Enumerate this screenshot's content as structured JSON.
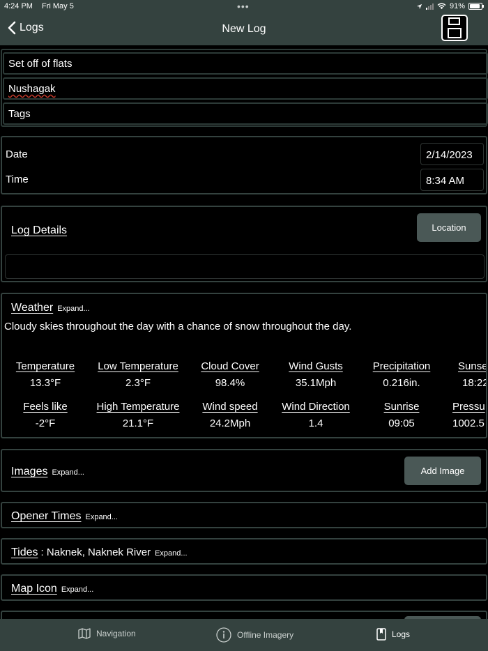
{
  "status": {
    "time": "4:24 PM",
    "date": "Fri May 5",
    "battery": "91%"
  },
  "nav": {
    "back_label": "Logs",
    "title": "New Log"
  },
  "header_fields": {
    "title_value": "Set off of flats",
    "location_value": "Nushagak",
    "tags_placeholder": "Tags"
  },
  "datetime": {
    "date_label": "Date",
    "date_value": "2/14/2023",
    "time_label": "Time",
    "time_value": "8:34 AM"
  },
  "log_details": {
    "heading": "Log Details",
    "location_button": "Location",
    "details_value": ""
  },
  "weather": {
    "heading": "Weather",
    "expand": "Expand...",
    "summary": "Cloudy skies throughout the day with a chance of snow throughout the day.",
    "row1": [
      {
        "label": "Temperature",
        "value": "13.3°F"
      },
      {
        "label": "Low Temperature",
        "value": "2.3°F"
      },
      {
        "label": "Cloud Cover",
        "value": "98.4%"
      },
      {
        "label": "Wind Gusts",
        "value": "35.1Mph"
      },
      {
        "label": "Precipitation",
        "value": "0.216in."
      },
      {
        "label": "Sunse",
        "value": "18:22"
      }
    ],
    "row2": [
      {
        "label": "Feels like",
        "value": "-2°F"
      },
      {
        "label": "High Temperature",
        "value": "21.1°F"
      },
      {
        "label": "Wind speed",
        "value": "24.2Mph"
      },
      {
        "label": "Wind Direction",
        "value": "1.4"
      },
      {
        "label": "Sunrise",
        "value": "09:05"
      },
      {
        "label": "Pressu",
        "value": "1002.5"
      }
    ]
  },
  "images": {
    "heading": "Images",
    "expand": "Expand...",
    "add_button": "Add Image"
  },
  "opener_times": {
    "heading": "Opener Times",
    "expand": "Expand..."
  },
  "tides": {
    "heading": "Tides",
    "station": ": Naknek, Naknek River",
    "expand": "Expand..."
  },
  "map_icon": {
    "heading": "Map Icon",
    "expand": "Expand..."
  },
  "tabbar": {
    "tab1": "Navigation",
    "tab2": "Offline Imagery",
    "tab3": "Logs"
  }
}
